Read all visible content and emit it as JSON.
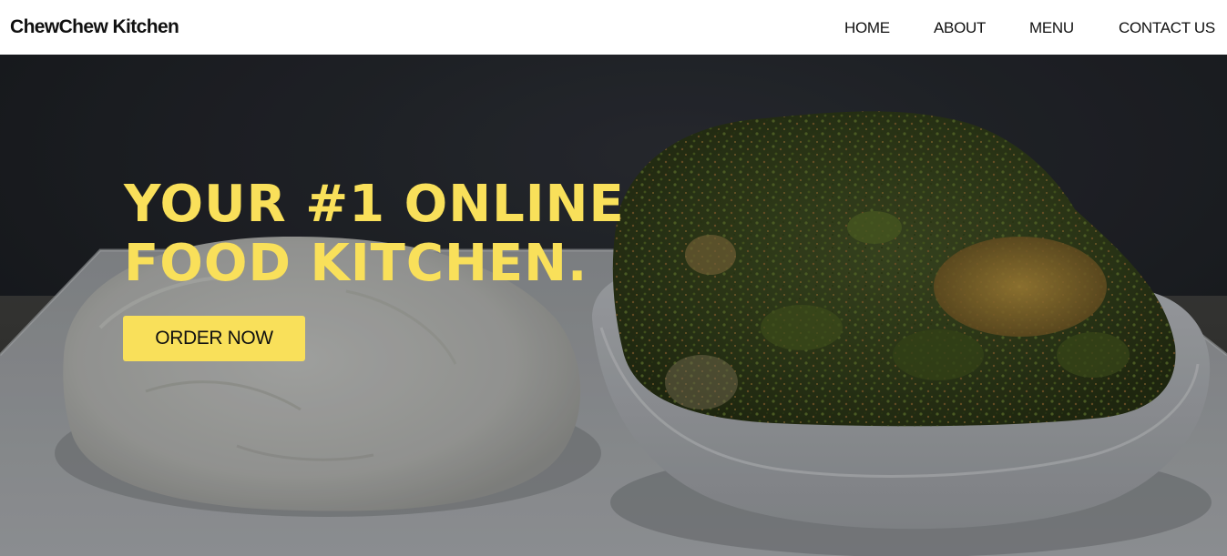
{
  "brand": {
    "name": "ChewChew Kitchen"
  },
  "nav": {
    "items": [
      {
        "label": "HOME"
      },
      {
        "label": "ABOUT"
      },
      {
        "label": "MENU"
      },
      {
        "label": "CONTACT US"
      }
    ]
  },
  "hero": {
    "title_line1": "YOUR #1 ONLINE",
    "title_line2": "FOOD KITCHEN.",
    "cta_label": "ORDER NOW",
    "background_image": "pounded-yam-and-vegetable-soup-photo"
  },
  "colors": {
    "accent": "#f9e05a",
    "navbar_bg": "#ffffff",
    "text_dark": "#111111"
  }
}
